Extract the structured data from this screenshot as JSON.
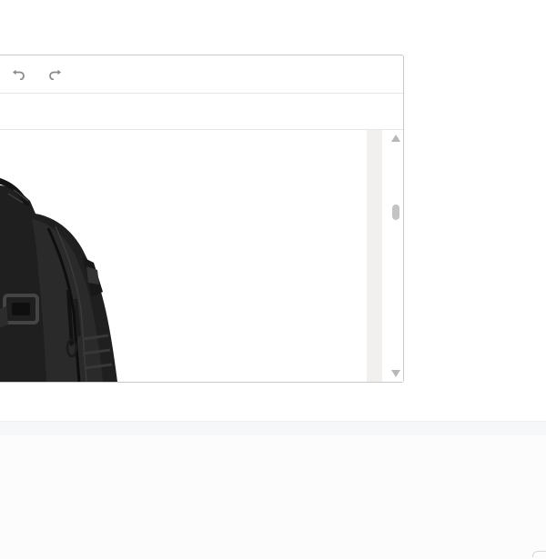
{
  "editor": {
    "toolbar": {
      "undo_icon": "undo-icon",
      "redo_icon": "redo-icon"
    },
    "content": {
      "image_subject": "black-backpack-image"
    }
  },
  "colors": {
    "border": "#c8c8c8",
    "toolbar_icon": "#8a8a8a",
    "scrollbar_track": "#f1f0ee",
    "scrollbar_thumb": "#c4c4c4",
    "footer_bar": "#f6f7f9"
  }
}
